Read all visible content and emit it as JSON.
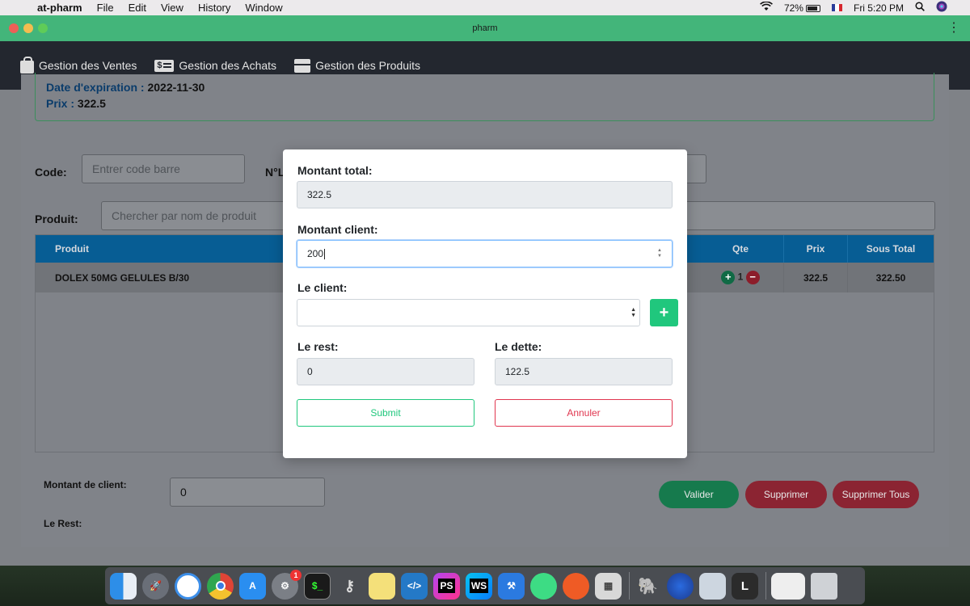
{
  "menubar": {
    "app_name": "at-pharm",
    "items": [
      "File",
      "Edit",
      "View",
      "History",
      "Window"
    ],
    "battery": "72%",
    "clock": "Fri 5:20 PM"
  },
  "window": {
    "title": "pharm"
  },
  "nav": {
    "ventes": "Gestion des Ventes",
    "achats": "Gestion des Achats",
    "produits": "Gestion des Produits"
  },
  "info": {
    "expiration_label": "Date d'expiration :",
    "expiration_value": "2022-11-30",
    "prix_label": "Prix :",
    "prix_value": "322.5"
  },
  "form": {
    "code_label": "Code:",
    "code_placeholder": "Entrer code barre",
    "lot_label": "N°L",
    "produit_label": "Produit:",
    "produit_placeholder": "Chercher par nom de produit"
  },
  "table": {
    "headers": {
      "produit": "Produit",
      "qte": "Qte",
      "prix": "Prix",
      "sous_total": "Sous Total"
    },
    "rows": [
      {
        "produit": "DOLEX 50MG GELULES B/30",
        "qte": "1",
        "prix": "322.5",
        "sous_total": "322.50"
      }
    ]
  },
  "footer": {
    "montant_client_label": "Montant de client:",
    "montant_client_value": "0",
    "rest_label": "Le Rest:",
    "valider": "Valider",
    "supprimer": "Supprimer",
    "supprimer_tous": "Supprimer Tous"
  },
  "modal": {
    "montant_total_label": "Montant total:",
    "montant_total_value": "322.5",
    "montant_client_label": "Montant client:",
    "montant_client_value": "200",
    "client_label": "Le client:",
    "client_value": "",
    "rest_label": "Le rest:",
    "rest_value": "0",
    "dette_label": "Le dette:",
    "dette_value": "122.5",
    "submit": "Submit",
    "annuler": "Annuler"
  },
  "colors": {
    "titlebar": "#43b57a",
    "navbar": "#23272f",
    "table_header": "#075d94",
    "success": "#20c77d",
    "danger": "#e0364f"
  },
  "dock": {
    "apps": [
      "finder-icon",
      "launchpad-icon",
      "safari-icon",
      "chrome-icon",
      "app-store-icon",
      "system-preferences-icon",
      "terminal-icon",
      "keychain-icon",
      "stickies-icon",
      "vscode-icon",
      "phpstorm-icon",
      "webstorm-icon",
      "xcode-icon",
      "android-studio-icon",
      "postman-icon",
      "calculator-icon",
      "tableplus-icon",
      "firefox-icon",
      "preview-icon",
      "l-app-icon",
      "screenshot-icon",
      "trash-icon"
    ],
    "badge": "1"
  }
}
